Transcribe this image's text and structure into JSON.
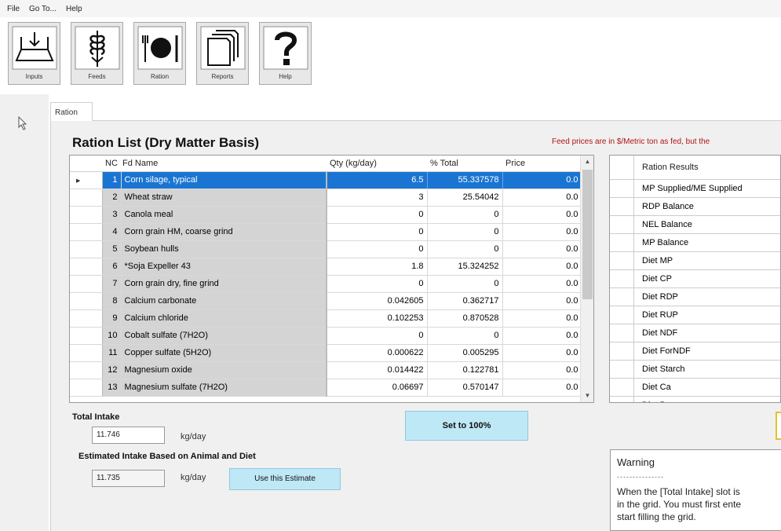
{
  "menu": {
    "file": "File",
    "goto": "Go To...",
    "help": "Help"
  },
  "toolbar": {
    "inputs": "Inputs",
    "feeds": "Feeds",
    "ration": "Ration",
    "reports": "Reports",
    "help": "Help"
  },
  "tab": {
    "label": "Ration"
  },
  "page": {
    "title": "Ration List (Dry Matter Basis)",
    "notice": "Feed prices are in $/Metric ton as fed, but the"
  },
  "ration_grid": {
    "columns": [
      "NC",
      "Fd  Name",
      "Qty (kg/day)",
      "% Total",
      "Price"
    ],
    "rows": [
      {
        "nc": "1",
        "name": "Corn silage, typical",
        "qty": "6.5",
        "pct": "55.337578",
        "price": "0.0"
      },
      {
        "nc": "2",
        "name": "Wheat straw",
        "qty": "3",
        "pct": "25.54042",
        "price": "0.0"
      },
      {
        "nc": "3",
        "name": "Canola meal",
        "qty": "0",
        "pct": "0",
        "price": "0.0"
      },
      {
        "nc": "4",
        "name": "Corn grain HM, coarse grind",
        "qty": "0",
        "pct": "0",
        "price": "0.0"
      },
      {
        "nc": "5",
        "name": "Soybean hulls",
        "qty": "0",
        "pct": "0",
        "price": "0.0"
      },
      {
        "nc": "6",
        "name": "*Soja Expeller 43",
        "qty": "1.8",
        "pct": "15.324252",
        "price": "0.0"
      },
      {
        "nc": "7",
        "name": "Corn grain dry, fine grind",
        "qty": "0",
        "pct": "0",
        "price": "0.0"
      },
      {
        "nc": "8",
        "name": "Calcium carbonate",
        "qty": "0.042605",
        "pct": "0.362717",
        "price": "0.0"
      },
      {
        "nc": "9",
        "name": "Calcium chloride",
        "qty": "0.102253",
        "pct": "0.870528",
        "price": "0.0"
      },
      {
        "nc": "10",
        "name": "Cobalt sulfate (7H2O)",
        "qty": "0",
        "pct": "0",
        "price": "0.0"
      },
      {
        "nc": "11",
        "name": "Copper sulfate (5H2O)",
        "qty": "0.000622",
        "pct": "0.005295",
        "price": "0.0"
      },
      {
        "nc": "12",
        "name": "Magnesium oxide",
        "qty": "0.014422",
        "pct": "0.122781",
        "price": "0.0"
      },
      {
        "nc": "13",
        "name": "Magnesium sulfate (7H2O)",
        "qty": "0.06697",
        "pct": "0.570147",
        "price": "0.0"
      }
    ]
  },
  "results_grid": {
    "header": "Ration Results",
    "rows": [
      "MP Supplied/ME Supplied",
      "RDP Balance",
      "NEL Balance",
      "MP Balance",
      "Diet MP",
      "Diet CP",
      "Diet RDP",
      "Diet RUP",
      "Diet NDF",
      "Diet ForNDF",
      "Diet Starch",
      "Diet Ca",
      "Diet P"
    ]
  },
  "intake": {
    "total_label": "Total Intake",
    "total_value": "11.746",
    "unit": "kg/day",
    "set_button": "Set to 100%",
    "estimated_label": "Estimated Intake Based on Animal and Diet",
    "estimated_value": "11.735",
    "use_button": "Use this Estimate"
  },
  "warning": {
    "title": "Warning",
    "divider": "---------------",
    "line1": "When the [Total Intake] slot is",
    "line2": "in the grid. You must first ente",
    "line3": "start filling the grid."
  }
}
